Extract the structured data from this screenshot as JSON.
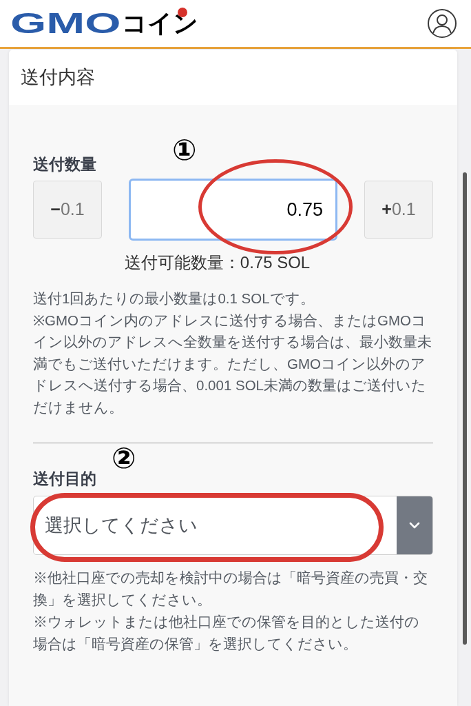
{
  "header": {
    "logo": {
      "latin": "GMO",
      "kana": "コイン"
    }
  },
  "card": {
    "title": "送付内容",
    "amount": {
      "marker": "①",
      "label": "送付数量",
      "decrement": {
        "sign": "−",
        "step": "0.1"
      },
      "input": {
        "value": "0.75",
        "focused": true,
        "highlighted": true
      },
      "increment": {
        "sign": "+",
        "step": "0.1"
      },
      "available": "送付可能数量：0.75 SOL",
      "notes": [
        "送付1回あたりの最小数量は0.1 SOLです。",
        "※GMOコイン内のアドレスに送付する場合、またはGMOコイン以外のアドレスへ全数量を送付する場合は、最小数量未満でもご送付いただけます。ただし、GMOコイン以外のアドレスへ送付する場合、0.001 SOL未満の数量はご送付いただけません。"
      ]
    },
    "purpose": {
      "marker": "②",
      "label": "送付目的",
      "select": {
        "placeholder": "選択してください",
        "highlighted": true
      },
      "notes": [
        "※他社口座での売却を検討中の場合は「暗号資産の売買・交換」を選択してください。",
        "※ウォレットまたは他社口座での保管を目的とした送付の場合は「暗号資産の保管」を選択してください。"
      ]
    }
  }
}
